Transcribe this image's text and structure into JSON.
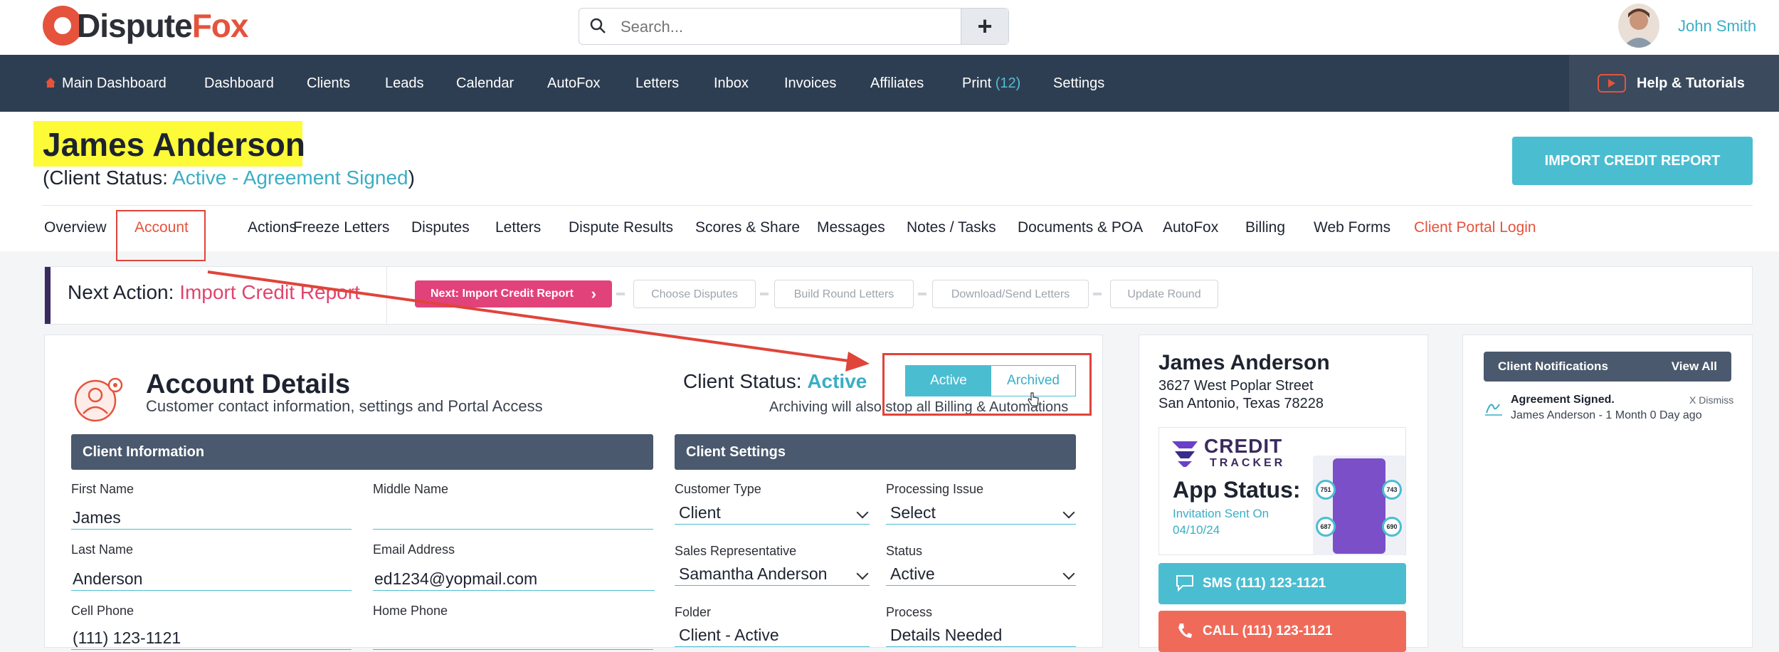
{
  "brand": {
    "name_part1": "Dispute",
    "name_part2": "Fox"
  },
  "search": {
    "placeholder": "Search...",
    "add_label": "+"
  },
  "user": {
    "name": "John Smith"
  },
  "nav": {
    "items": [
      {
        "label": "Main Dashboard",
        "icon": "home-icon"
      },
      {
        "label": "Dashboard"
      },
      {
        "label": "Clients"
      },
      {
        "label": "Leads"
      },
      {
        "label": "Calendar"
      },
      {
        "label": "AutoFox"
      },
      {
        "label": "Letters"
      },
      {
        "label": "Inbox"
      },
      {
        "label": "Invoices"
      },
      {
        "label": "Affiliates"
      },
      {
        "label": "Print",
        "count": "(12)"
      },
      {
        "label": "Settings"
      }
    ],
    "help_label": "Help & Tutorials"
  },
  "client": {
    "name": "James Anderson",
    "status_prefix": "(Client Status: ",
    "status_value": "Active - Agreement Signed",
    "status_suffix": ")"
  },
  "import_button": "IMPORT CREDIT REPORT",
  "tabs": [
    {
      "label": "Overview"
    },
    {
      "label": "Account",
      "active": true
    },
    {
      "label": "Actions"
    },
    {
      "label": "Freeze Letters"
    },
    {
      "label": "Disputes"
    },
    {
      "label": "Letters"
    },
    {
      "label": "Dispute Results"
    },
    {
      "label": "Scores & Share"
    },
    {
      "label": "Messages"
    },
    {
      "label": "Notes / Tasks"
    },
    {
      "label": "Documents & POA"
    },
    {
      "label": "AutoFox"
    },
    {
      "label": "Billing"
    },
    {
      "label": "Web Forms"
    },
    {
      "label": "Client Portal Login"
    }
  ],
  "next_action": {
    "label": "Next Action: ",
    "value": "Import Credit Report",
    "current_step": "Next: Import Credit Report",
    "steps": [
      "Choose Disputes",
      "Build Round Letters",
      "Download/Send Letters",
      "Update Round"
    ]
  },
  "account": {
    "title": "Account Details",
    "subtitle": "Customer contact information, settings and Portal Access",
    "client_status_label": "Client Status: ",
    "client_status_value": "Active",
    "toggle_active": "Active",
    "toggle_archived": "Archived",
    "archive_note": "Archiving will also stop all Billing & Automations",
    "client_info_header": "Client Information",
    "client_settings_header": "Client Settings",
    "fields": {
      "first_name_label": "First Name",
      "first_name": "James",
      "middle_name_label": "Middle Name",
      "middle_name": "",
      "last_name_label": "Last Name",
      "last_name": "Anderson",
      "email_label": "Email Address",
      "email": "ed1234@yopmail.com",
      "cell_label": "Cell Phone",
      "cell": "(111) 123-1121",
      "home_label": "Home Phone",
      "home": ""
    },
    "settings": {
      "customer_type_label": "Customer Type",
      "customer_type": "Client",
      "processing_issue_label": "Processing Issue",
      "processing_issue": "Select",
      "sales_rep_label": "Sales Representative",
      "sales_rep": "Samantha Anderson",
      "status_label": "Status",
      "status": "Active",
      "folder_label": "Folder",
      "folder": "Client - Active",
      "process_label": "Process",
      "process": "Details Needed"
    }
  },
  "side": {
    "name": "James Anderson",
    "address1": "3627 West Poplar Street",
    "address2": "San Antonio, Texas 78228",
    "ct_brand1": "CREDIT",
    "ct_brand2": "TRACKER",
    "app_status": "App Status:",
    "app_sub1": "Invitation Sent On",
    "app_sub2": "04/10/24",
    "gauges": [
      "751",
      "743",
      "687",
      "690"
    ],
    "sms": "SMS (111) 123-1121",
    "call": "CALL (111) 123-1121"
  },
  "notifications": {
    "header": "Client Notifications",
    "view_all": "View All",
    "items": [
      {
        "title": "Agreement Signed.",
        "dismiss": "X Dismiss",
        "sub": "James Anderson - 1 Month 0 Day ago"
      }
    ]
  },
  "colors": {
    "brand": "#e5533d",
    "nav_bg": "#2e3e52",
    "accent": "#4bbdd1",
    "next_action": "#e0446f",
    "highlight": "#fdfa38",
    "annotation": "#e0443a"
  }
}
